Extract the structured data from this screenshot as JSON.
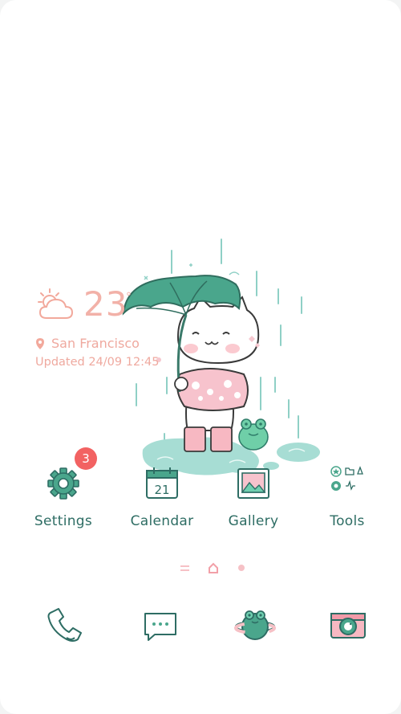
{
  "weather": {
    "temperature": "23",
    "degree_symbol": "°",
    "city": "San Francisco",
    "updated": "Updated 24/09 12:45",
    "icon": "partly-cloudy-icon"
  },
  "apps": [
    {
      "label": "Settings",
      "icon": "gear-icon",
      "badge": "3"
    },
    {
      "label": "Calendar",
      "icon": "calendar-icon",
      "date": "21"
    },
    {
      "label": "Gallery",
      "icon": "gallery-icon"
    },
    {
      "label": "Tools",
      "icon": "tools-folder-icon"
    }
  ],
  "pager": {
    "icons": [
      "menu-lines-icon",
      "home-icon",
      "page-dot-icon"
    ]
  },
  "dock": [
    {
      "icon": "phone-icon"
    },
    {
      "icon": "messages-icon"
    },
    {
      "icon": "frog-planet-icon"
    },
    {
      "icon": "camera-icon"
    }
  ],
  "colors": {
    "accent": "#2e6d64",
    "teal": "#5fbfb0",
    "pink": "#f2b1a8",
    "badge": "#f26262"
  }
}
